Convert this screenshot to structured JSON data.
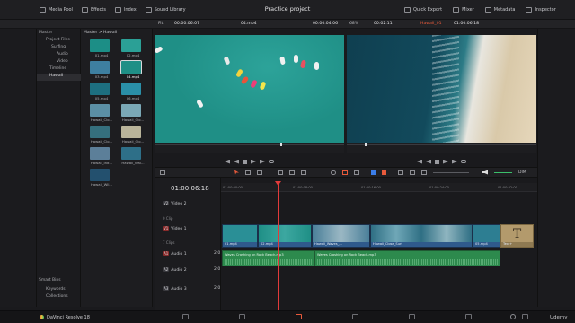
{
  "topbar": {
    "buttons": [
      "Media Pool",
      "Effects",
      "Index",
      "Sound Library"
    ],
    "title": "Practice project",
    "right_buttons": [
      "Quick Export",
      "Mixer",
      "Metadata",
      "Inspector"
    ]
  },
  "source_viewer": {
    "fit": "Fit",
    "timecode_in": "00:00:06:07",
    "clip_name": "04.mp4",
    "duration": "00:00:04:06"
  },
  "timeline_viewer": {
    "zoom": "68%",
    "timecode": "00:02:11",
    "timeline_name": "Hawaii_01",
    "position": "01:00:06:18"
  },
  "bins": {
    "header": "Master",
    "items": [
      "Project Files",
      "Surfing",
      "Audio",
      "Video",
      "Timeline",
      "Hawaii"
    ],
    "smart_bins": "Smart Bins",
    "smart_items": [
      "Keywords",
      "Collections"
    ]
  },
  "pool": {
    "path": "Master > Hawaii",
    "clips": [
      "01.mp4",
      "02.mp4",
      "03.mp4",
      "04.mp4",
      "05.mp4",
      "06.mp4",
      "Hawaii_Clo...",
      "Hawaii_Clo...",
      "Hawaii_Clo...",
      "Hawaii_Clo...",
      "Hawaii_Ind...",
      "Hawaii_Wal...",
      "Hawaii_Wil..."
    ]
  },
  "timeline": {
    "timecode": "01:00:06:18",
    "ruler": [
      "01:00:00:00",
      "01:00:08:00",
      "01:00:16:00",
      "01:00:24:00",
      "01:00:32:00"
    ],
    "tracks": [
      {
        "id": "V2",
        "name": "Video 2",
        "clips_label": "0 Clip"
      },
      {
        "id": "V1",
        "name": "Video 1",
        "clips_label": "7 Clips"
      },
      {
        "id": "A1",
        "name": "Audio 1",
        "level": "2.0"
      },
      {
        "id": "A2",
        "name": "Audio 2",
        "level": "2.0"
      },
      {
        "id": "A3",
        "name": "Audio 3",
        "level": "2.0"
      }
    ],
    "video_clips": [
      "01.mp4",
      "02.mp4",
      "Hawaii_Waves_...",
      "Hawaii_Close_Surf",
      "05.mp4",
      "Text+"
    ],
    "audio_clips": [
      "Waves Crashing on Rock Beach.mp3",
      "Waves Crashing on Rock Beach.mp3"
    ],
    "volume_label": "DIM"
  },
  "bottombar": {
    "app_name": "DaVinci Resolve 18",
    "watermark": "Udemy"
  },
  "colors": {
    "playhead": "#e23b3b",
    "video_clip": "#2b5a8f",
    "audio_clip": "#2d8a4d",
    "accent": "#e85a3b"
  }
}
